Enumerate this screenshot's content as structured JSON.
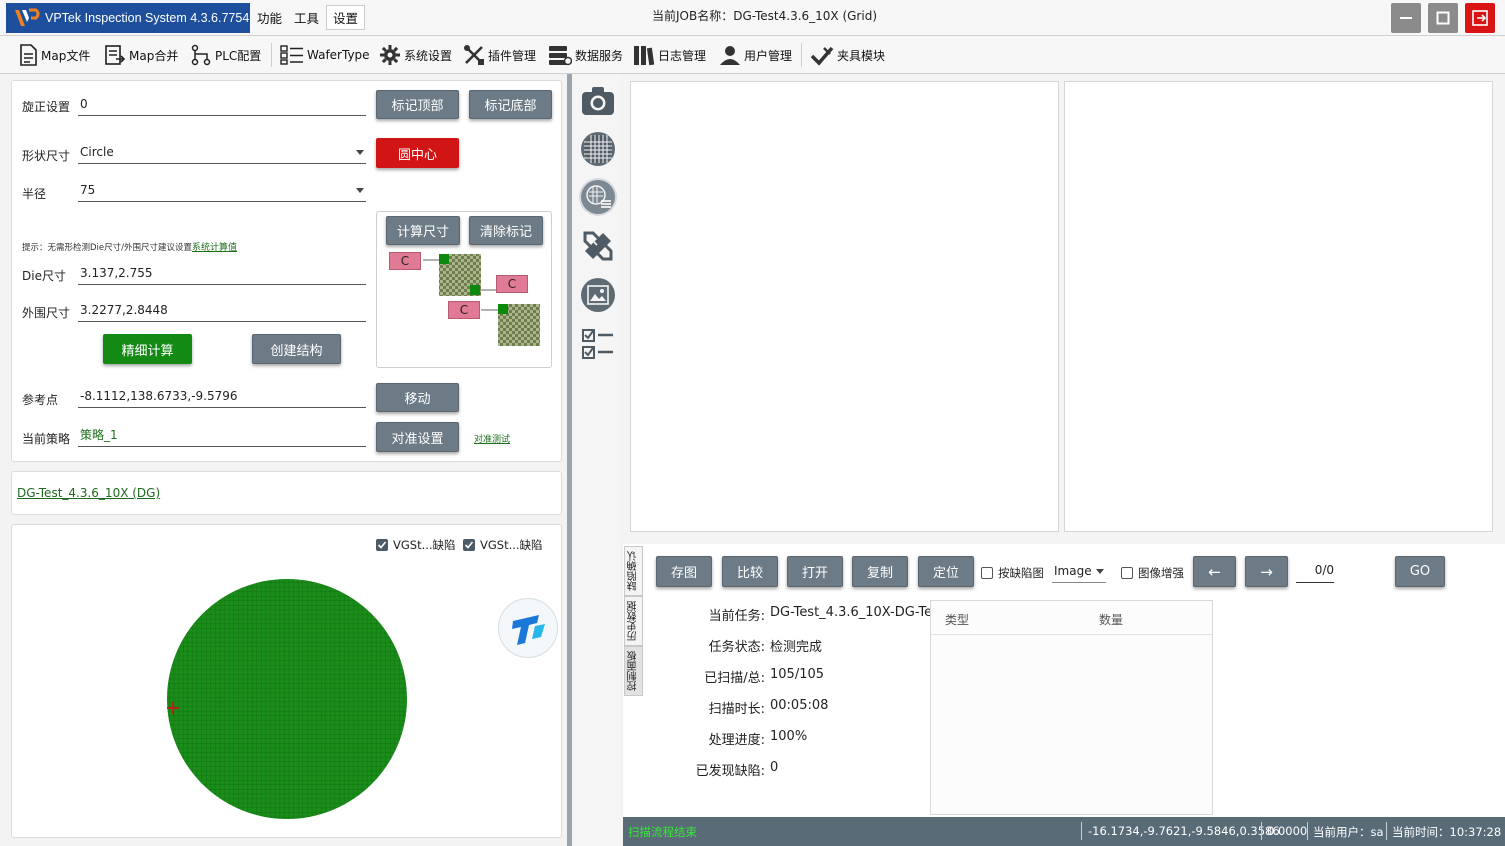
{
  "app": {
    "title": "VPTek Inspection System 4.3.6.7754",
    "menu": [
      "功能",
      "工具",
      "设置"
    ],
    "job_title": "当前JOB名称：DG-Test4.3.6_10X (Grid)"
  },
  "toolbar": {
    "items": [
      {
        "label": "Map文件",
        "icon": "file-icon"
      },
      {
        "label": "Map合并",
        "icon": "merge-icon"
      },
      {
        "label": "PLC配置",
        "icon": "plc-icon"
      },
      {
        "label": "WaferType",
        "icon": "grid-list-icon"
      },
      {
        "label": "系统设置",
        "icon": "gear-icon"
      },
      {
        "label": "插件管理",
        "icon": "tools-icon"
      },
      {
        "label": "数据服务",
        "icon": "database-icon"
      },
      {
        "label": "日志管理",
        "icon": "books-icon"
      },
      {
        "label": "用户管理",
        "icon": "user-icon"
      },
      {
        "label": "夹具模块",
        "icon": "fixture-icon"
      }
    ]
  },
  "align": {
    "rotate_label": "旋正设置",
    "rotate_value": "0",
    "mark_top": "标记顶部",
    "mark_bottom": "标记底部",
    "shape_label": "形状尺寸",
    "shape_value": "Circle",
    "circle_center": "圆中心",
    "radius_label": "半径",
    "radius_value": "75",
    "calc_size": "计算尺寸",
    "clear_marks": "清除标记",
    "hint_prefix": "提示：无需形检测Die尺寸/外围尺寸建议设置",
    "hint_link": "系统计算值",
    "die_label": "Die尺寸",
    "die_value": "3.137,2.755",
    "outer_label": "外围尺寸",
    "outer_value": "3.2277,2.8448",
    "fine_calc": "精细计算",
    "create_struct": "创建结构",
    "ref_label": "参考点",
    "ref_value": "-8.1112,138.6733,-9.5796",
    "move": "移动",
    "strategy_label": "当前策略",
    "strategy_value": "策略_1",
    "align_settings": "对准设置",
    "align_test": "对准测试",
    "diagram_letter": "C"
  },
  "recipe_link": "DG-Test_4.3.6_10X (DG)",
  "wafer_map": {
    "filter1": "VGSt...缺陷",
    "filter2": "VGSt...缺陷",
    "wafer_color": "#1a8c1a"
  },
  "side_tabs": [
    "缺陷确认",
    "历史数据",
    "控制面板"
  ],
  "actions": {
    "save_image": "存图",
    "compare": "比较",
    "open": "打开",
    "copy": "复制",
    "locate": "定位",
    "by_defect": "按缺陷图",
    "image_mode": "Image",
    "image_enhance": "图像增强",
    "prev": "←",
    "next": "→",
    "counter": "0/0",
    "go": "GO"
  },
  "task_info": [
    {
      "k": "当前任务:",
      "v": "DG-Test_4.3.6_10X-DG-Te"
    },
    {
      "k": "任务状态:",
      "v": "检测完成"
    },
    {
      "k": "已扫描/总:",
      "v": "105/105"
    },
    {
      "k": "扫描时长:",
      "v": "00:05:08"
    },
    {
      "k": "处理进度:",
      "v": "100%"
    },
    {
      "k": "已发现缺陷:",
      "v": "0"
    }
  ],
  "defect_table": {
    "col_type": "类型",
    "col_count": "数量"
  },
  "status": {
    "message": "扫描流程结束",
    "coords": "-16.1734,-9.7621,-9.5846,0.3586",
    "value": "0.0000",
    "user": "当前用户：sa",
    "time": "当前时间：10:37:28"
  }
}
